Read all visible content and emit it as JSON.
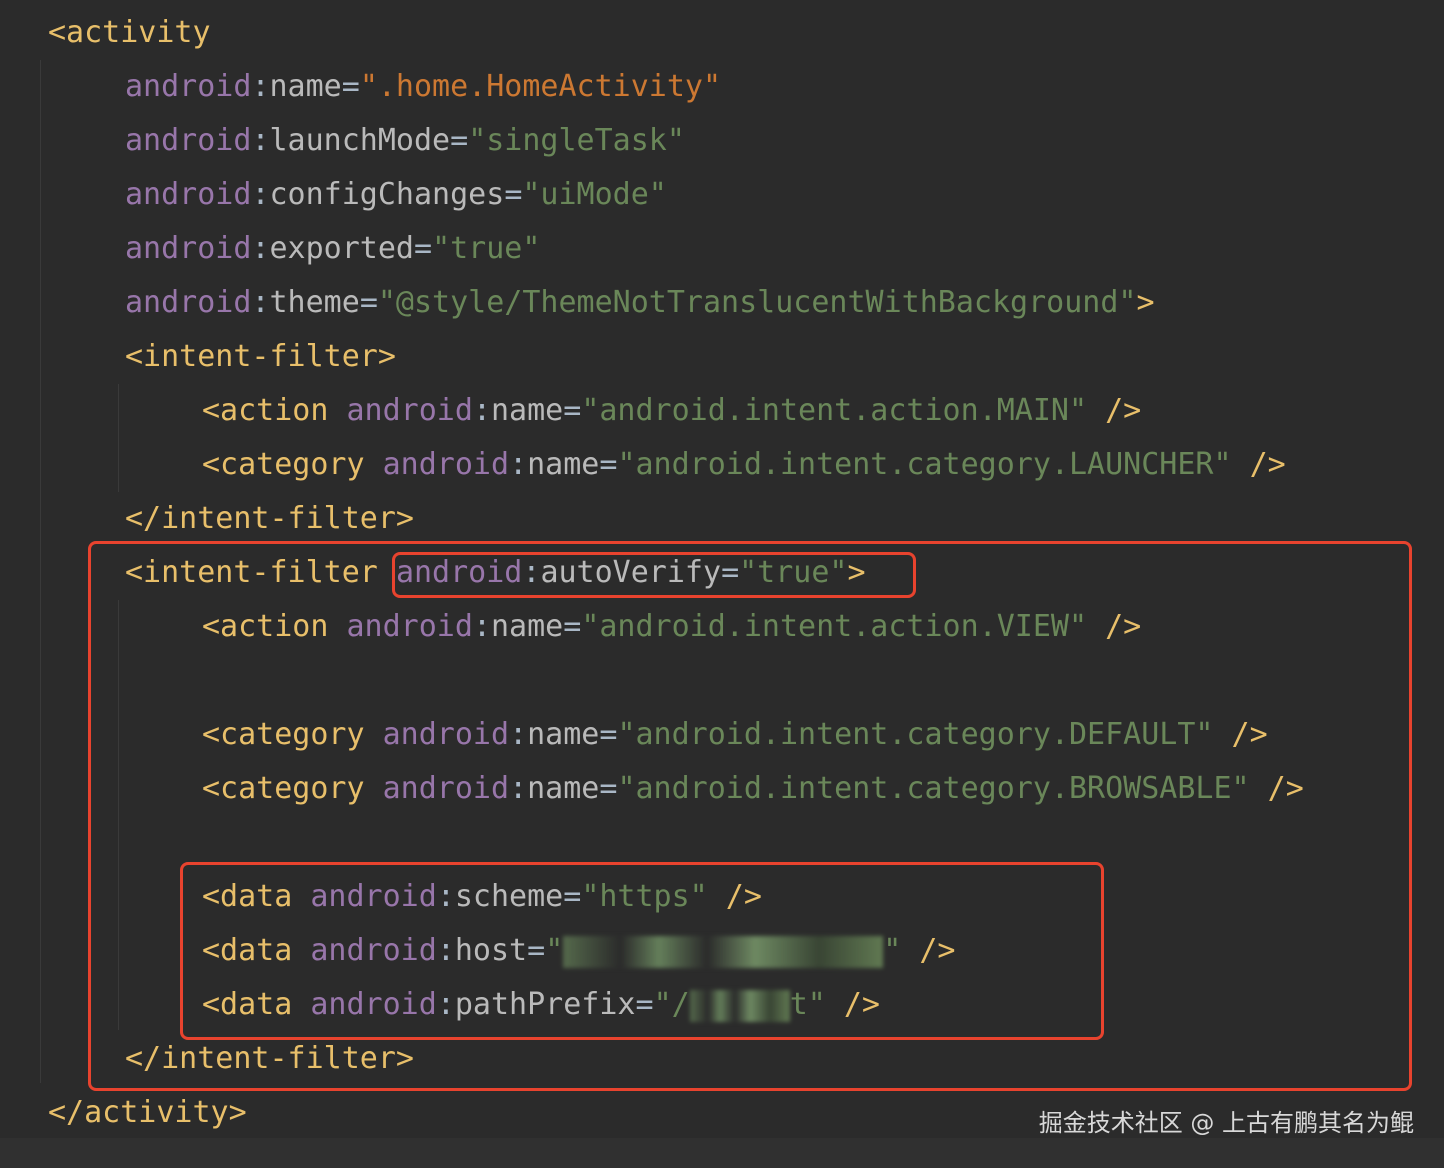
{
  "lines": [
    {
      "tag": "<activity"
    },
    {
      "ns": "android",
      "attr": "name",
      "val": "\".home.HomeActivity\""
    },
    {
      "ns": "android",
      "attr": "launchMode",
      "val": "\"singleTask\""
    },
    {
      "ns": "android",
      "attr": "configChanges",
      "val": "\"uiMode\""
    },
    {
      "ns": "android",
      "attr": "exported",
      "val": "\"true\""
    },
    {
      "ns": "android",
      "attr": "theme",
      "val": "\"@style/ThemeNotTranslucentWithBackground\"",
      "end": ">"
    },
    {
      "tag": "<intent-filter>"
    },
    {
      "tag": "<action",
      "ns": "android",
      "attr": "name",
      "val": "\"android.intent.action.MAIN\"",
      "end": " />"
    },
    {
      "tag": "<category",
      "ns": "android",
      "attr": "name",
      "val": "\"android.intent.category.LAUNCHER\"",
      "end": " />"
    },
    {
      "tag": "</intent-filter>"
    },
    {
      "tag": "<intent-filter",
      "ns": "android",
      "attr": "autoVerify",
      "val": "\"true\"",
      "end": ">"
    },
    {
      "tag": "<action",
      "ns": "android",
      "attr": "name",
      "val": "\"android.intent.action.VIEW\"",
      "end": " />"
    },
    {
      "tag": "<category",
      "ns": "android",
      "attr": "name",
      "val": "\"android.intent.category.DEFAULT\"",
      "end": " />"
    },
    {
      "tag": "<category",
      "ns": "android",
      "attr": "name",
      "val": "\"android.intent.category.BROWSABLE\"",
      "end": " />"
    },
    {
      "tag": "<data",
      "ns": "android",
      "attr": "scheme",
      "val": "\"https\"",
      "end": " />"
    },
    {
      "tag": "<data",
      "ns": "android",
      "attr": "host",
      "val_prefix": "\"",
      "val_suffix": "\"",
      "end": " />"
    },
    {
      "tag": "<data",
      "ns": "android",
      "attr": "pathPrefix",
      "val_prefix": "\"/",
      "val_suffix": "t\"",
      "end": " />"
    },
    {
      "tag": "</intent-filter>"
    },
    {
      "tag": "</activity>"
    }
  ],
  "watermark": "掘金技术社区 @ 上古有鹏其名为鲲",
  "colors": {
    "highlight_border": "#e8432e",
    "tag": "#e8bf6a",
    "namespace": "#9876aa",
    "value": "#6a8759",
    "background": "#2b2b2b"
  }
}
